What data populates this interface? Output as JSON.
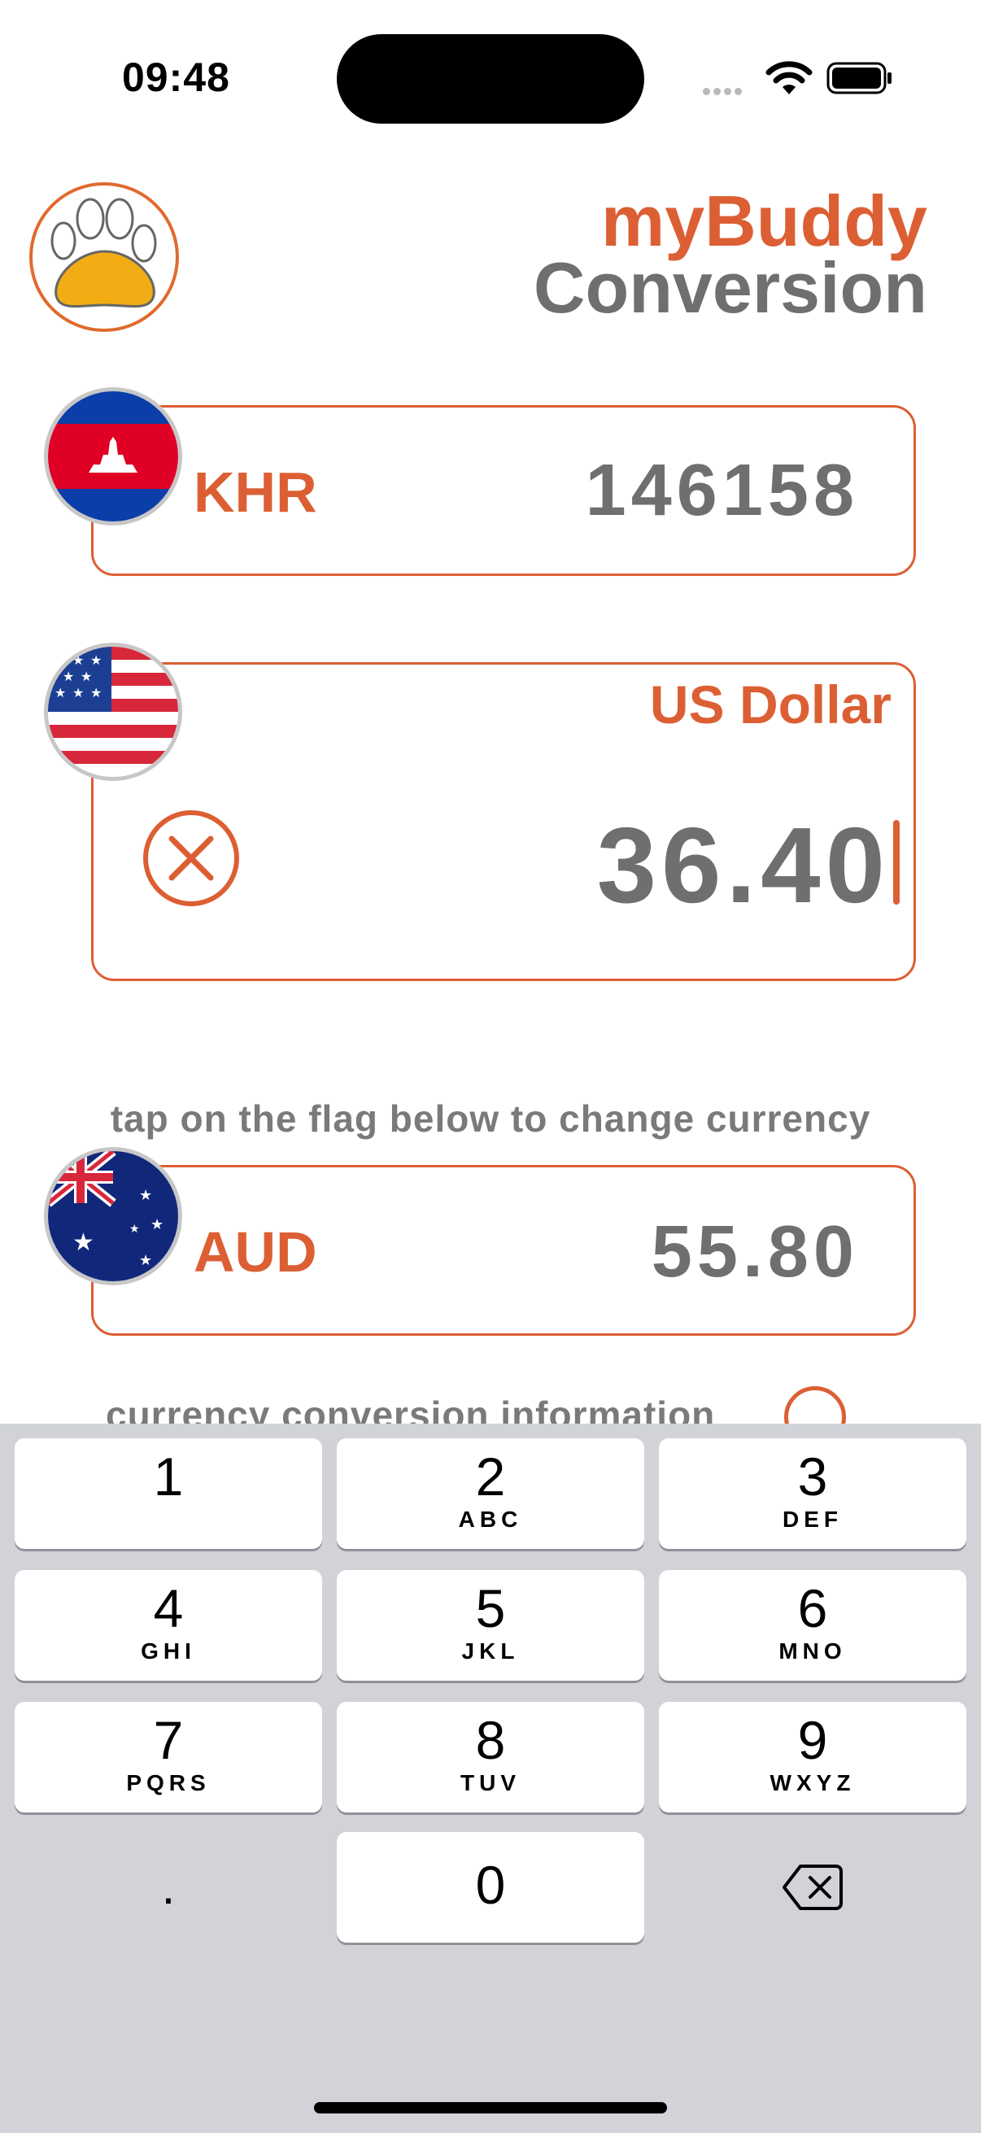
{
  "status_bar": {
    "time": "09:48"
  },
  "header": {
    "brand": "myBuddy",
    "title": "Conversion",
    "logo_icon": "paw-icon"
  },
  "currencies": {
    "base": {
      "code": "KHR",
      "amount": "146158",
      "flag_icon": "cambodia-flag-icon"
    },
    "active": {
      "name": "US Dollar",
      "amount": "36.40",
      "flag_icon": "usa-flag-icon",
      "clear_icon": "clear-icon"
    },
    "hint": "tap on the flag below to change currency",
    "target": {
      "code": "AUD",
      "amount": "55.80",
      "flag_icon": "australia-flag-icon"
    }
  },
  "info": {
    "text": "currency conversion information",
    "icon": "info-icon"
  },
  "keyboard": {
    "keys": [
      {
        "digit": "1",
        "letters": ""
      },
      {
        "digit": "2",
        "letters": "ABC"
      },
      {
        "digit": "3",
        "letters": "DEF"
      },
      {
        "digit": "4",
        "letters": "GHI"
      },
      {
        "digit": "5",
        "letters": "JKL"
      },
      {
        "digit": "6",
        "letters": "MNO"
      },
      {
        "digit": "7",
        "letters": "PQRS"
      },
      {
        "digit": "8",
        "letters": "TUV"
      },
      {
        "digit": "9",
        "letters": "WXYZ"
      },
      {
        "digit": "0",
        "letters": ""
      }
    ],
    "decimal": ".",
    "delete_icon": "backspace-icon"
  },
  "colors": {
    "accent": "#dc5f34",
    "text_gray": "#6f6f6f",
    "keyboard_bg": "#d1d3d9"
  }
}
